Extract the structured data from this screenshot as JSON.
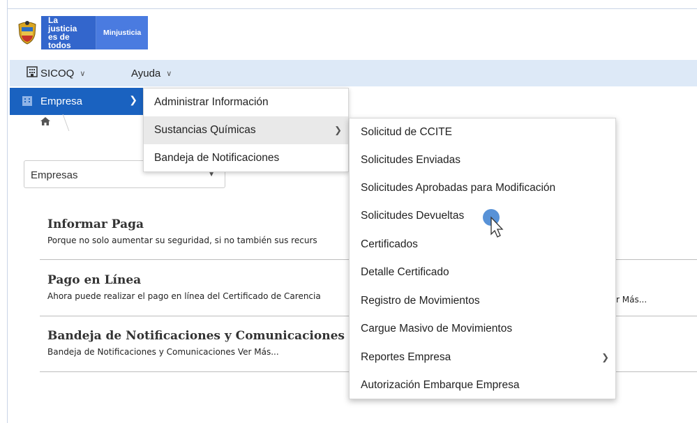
{
  "brand": {
    "tagline": "La justicia es de todos",
    "ministry": "Minjusticia"
  },
  "menubar": {
    "sicoq_label": "SICOQ",
    "ayuda_label": "Ayuda"
  },
  "sidebar": {
    "empresa_label": "Empresa"
  },
  "menu_level1": [
    {
      "label": "Administrar Información"
    },
    {
      "label": "Sustancias Químicas"
    },
    {
      "label": "Bandeja de Notificaciones"
    }
  ],
  "menu_level2": [
    {
      "label": "Solicitud de CCITE"
    },
    {
      "label": "Solicitudes Enviadas"
    },
    {
      "label": "Solicitudes Aprobadas para Modificación"
    },
    {
      "label": "Solicitudes Devueltas"
    },
    {
      "label": "Certificados"
    },
    {
      "label": "Detalle Certificado"
    },
    {
      "label": "Registro de Movimientos"
    },
    {
      "label": "Cargue Masivo de Movimientos"
    },
    {
      "label": "Reportes Empresa"
    },
    {
      "label": "Autorización Embarque Empresa"
    }
  ],
  "select": {
    "value": "Empresas"
  },
  "sections": [
    {
      "title": "Informar Paga",
      "desc": "Porque no solo aumentar su seguridad, si no también sus recurs"
    },
    {
      "title": "Pago en Línea",
      "desc": "Ahora puede realizar el pago en línea del Certificado de Carencia"
    },
    {
      "title": "Bandeja de Notificaciones y Comunicaciones",
      "desc": "Bandeja de Notificaciones y Comunicaciones Ver Más..."
    }
  ],
  "pago_vermas": "r Más...",
  "colors": {
    "accent": "#1a62c0",
    "menubar_bg": "#dde9f7",
    "brand_blue": "#3366cc"
  }
}
